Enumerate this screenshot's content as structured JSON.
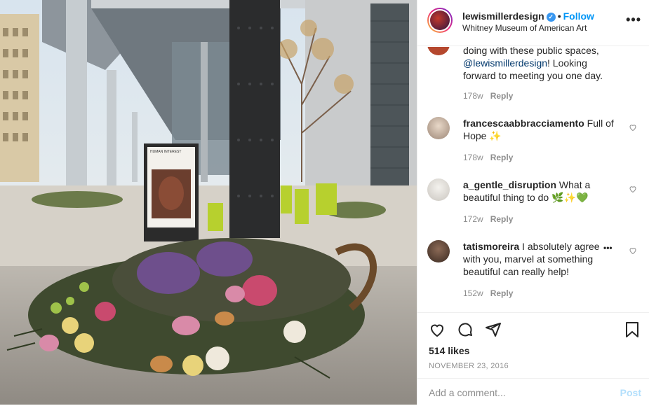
{
  "header": {
    "username": "lewismillerdesign",
    "verified_mark": "✓",
    "separator": "•",
    "follow_label": "Follow",
    "location": "Whitney Museum of American Art",
    "more_label": "•••"
  },
  "photo": {
    "poster_text": "HUMAN INTEREST: PORTRAITS FROM THE WHITNEY'S COLLECTION"
  },
  "comments": {
    "first": {
      "line1": "doing with these public spaces,",
      "mention": "@lewismillerdesign",
      "line2_rest": "! Looking",
      "line3": "forward to meeting you one day.",
      "time": "178w",
      "reply": "Reply"
    },
    "items": [
      {
        "user": "francescaabbracciamento",
        "text1": " Full of",
        "text2": "Hope ✨",
        "time": "178w",
        "reply": "Reply"
      },
      {
        "user": "a_gentle_disruption",
        "text1": " What a",
        "text2": "beautiful thing to do 🌿✨💚",
        "time": "172w",
        "reply": "Reply"
      },
      {
        "user": "tatismoreira",
        "text1": " I absolutely agree",
        "text2": "with you, marvel at something",
        "text3": "beautiful can really help!",
        "time": "152w",
        "reply": "Reply",
        "more": "•••"
      }
    ]
  },
  "actions": {
    "likes": "514 likes",
    "date": "NOVEMBER 23, 2016"
  },
  "add_comment": {
    "placeholder": "Add a comment...",
    "post_label": "Post"
  }
}
